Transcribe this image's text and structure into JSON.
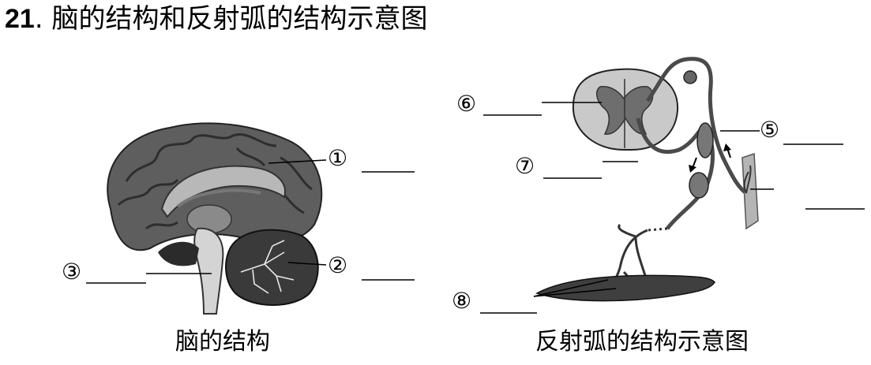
{
  "title": {
    "number": "21",
    "separator": ".",
    "text": "脑的结构和反射弧的结构示意图"
  },
  "brain": {
    "caption": "脑的结构",
    "labels": [
      "①",
      "②",
      "③"
    ]
  },
  "reflex_arc": {
    "caption": "反射弧的结构示意图",
    "labels": [
      "⑤",
      "⑥",
      "⑦",
      "⑧"
    ]
  },
  "colors": {
    "ink": "#000000",
    "brain_gray": "#6b6b6b",
    "brain_dark": "#3a3a3a",
    "tissue_light": "#c9c9c9"
  }
}
